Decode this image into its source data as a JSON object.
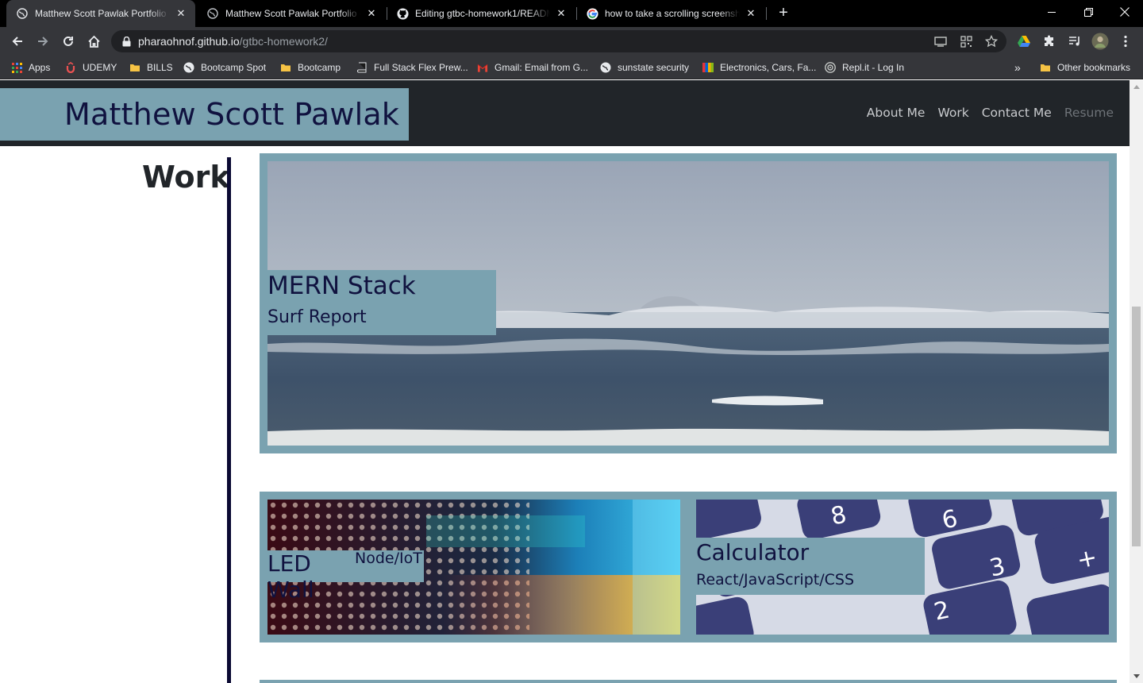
{
  "browser": {
    "tabs": [
      {
        "title": "Matthew Scott Pawlak Portfolio o",
        "icon": "globe-icon",
        "active": true
      },
      {
        "title": "Matthew Scott Pawlak Portfolio o",
        "icon": "globe-icon",
        "active": false
      },
      {
        "title": "Editing gtbc-homework1/READM",
        "icon": "github-icon",
        "active": false
      },
      {
        "title": "how to take a scrolling screensho",
        "icon": "google-icon",
        "active": false
      }
    ],
    "url_host": "pharaohnof.github.io",
    "url_path": "/gtbc-homework2/",
    "bookmarks": [
      {
        "label": "Apps",
        "icon": "apps-grid-icon"
      },
      {
        "label": "UDEMY",
        "icon": "udemy-icon"
      },
      {
        "label": "BILLS",
        "icon": "folder-icon"
      },
      {
        "label": "Bootcamp Spot",
        "icon": "globe-icon"
      },
      {
        "label": "Bootcamp",
        "icon": "folder-icon"
      },
      {
        "label": "Full Stack Flex Prew...",
        "icon": "book-icon"
      },
      {
        "label": "Gmail: Email from G...",
        "icon": "gmail-icon"
      },
      {
        "label": "sunstate security",
        "icon": "globe-icon"
      },
      {
        "label": "Electronics, Cars, Fa...",
        "icon": "ebay-icon"
      },
      {
        "label": "Repl.it - Log In",
        "icon": "replit-icon"
      }
    ],
    "more_bookmarks": "»",
    "other_bookmarks": "Other bookmarks"
  },
  "site": {
    "brand": "Matthew Scott Pawlak",
    "nav": [
      "About Me",
      "Work",
      "Contact Me",
      "Resume"
    ],
    "section_title": "Work",
    "projects": [
      {
        "title": "MERN Stack",
        "subtitle": "Surf Report",
        "image": "ocean-waves-photo"
      },
      {
        "title": "LED Wall",
        "subtitle": "Node/IoT",
        "image": "led-matrix-photo"
      },
      {
        "title": "Calculator",
        "subtitle": "React/JavaScript/CSS",
        "image": "calculator-keys-photo"
      }
    ]
  },
  "colors": {
    "accent": "#7aa2b0",
    "heading_navy": "#10123f",
    "header_bg": "#212529"
  }
}
